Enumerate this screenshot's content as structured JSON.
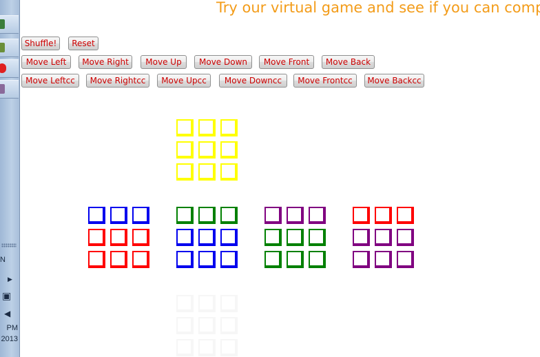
{
  "title": "Try our virtual game and see if you can compe",
  "taskbar": {
    "clock_time": "PM",
    "clock_year": "2013",
    "partial_label": "N"
  },
  "buttons": {
    "row1": [
      "Shuffle!",
      "Reset"
    ],
    "row2": [
      "Move Left",
      "Move Right",
      "Move Up",
      "Move Down",
      "Move Front",
      "Move Back"
    ],
    "row3": [
      "Move Leftcc",
      "Move Rightcc",
      "Move Upcc",
      "Move Downcc",
      "Move Frontcc",
      "Move Backcc"
    ]
  },
  "colors": {
    "title": "#f39c19",
    "button_text": "#cc0000",
    "yellow": "#ffff00",
    "blue": "#0000ee",
    "red": "#ff0000",
    "green": "#008000",
    "purple": "#800080",
    "ghost": "#f6f6f6"
  },
  "cube": {
    "top": [
      [
        "yellow",
        "yellow",
        "yellow"
      ],
      [
        "yellow",
        "yellow",
        "yellow"
      ],
      [
        "yellow",
        "yellow",
        "yellow"
      ]
    ],
    "left": [
      [
        "blue",
        "blue",
        "blue"
      ],
      [
        "red",
        "red",
        "red"
      ],
      [
        "red",
        "red",
        "red"
      ]
    ],
    "front": [
      [
        "green",
        "green",
        "green"
      ],
      [
        "blue",
        "blue",
        "blue"
      ],
      [
        "blue",
        "blue",
        "blue"
      ]
    ],
    "right": [
      [
        "purple",
        "purple",
        "purple"
      ],
      [
        "green",
        "green",
        "green"
      ],
      [
        "green",
        "green",
        "green"
      ]
    ],
    "back": [
      [
        "red",
        "red",
        "red"
      ],
      [
        "purple",
        "purple",
        "purple"
      ],
      [
        "purple",
        "purple",
        "purple"
      ]
    ],
    "bottom": [
      [
        "ghost",
        "ghost",
        "ghost"
      ],
      [
        "ghost",
        "ghost",
        "ghost"
      ],
      [
        "ghost",
        "ghost",
        "ghost"
      ]
    ]
  }
}
